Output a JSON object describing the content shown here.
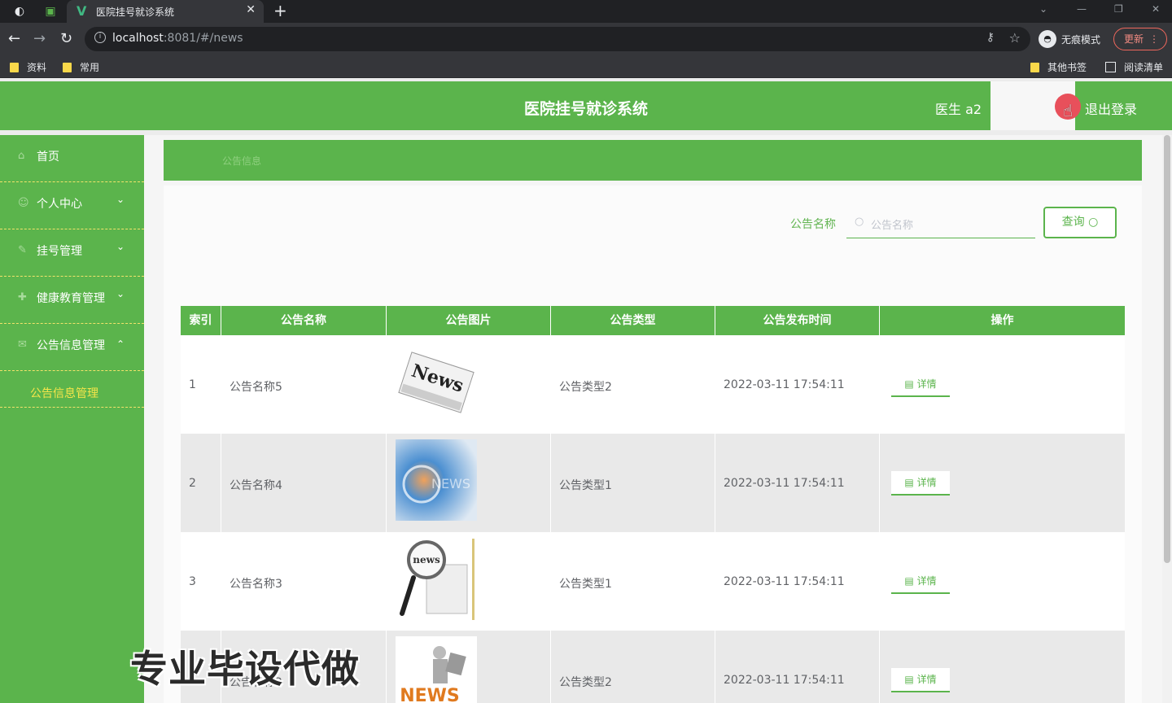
{
  "browser": {
    "tab_title": "医院挂号就诊系统",
    "url_host": "localhost",
    "url_path": ":8081/#/news",
    "incognito_label": "无痕模式",
    "update_label": "更新",
    "bookmarks": [
      "资料",
      "常用"
    ],
    "other_bookmarks": "其他书签",
    "reading_list": "阅读清单"
  },
  "header": {
    "title": "医院挂号就诊系统",
    "user": "医生 a2",
    "logout": "退出登录"
  },
  "sidebar": {
    "items": [
      {
        "label": "首页",
        "icon": "home-icon"
      },
      {
        "label": "个人中心",
        "icon": "user-icon"
      },
      {
        "label": "挂号管理",
        "icon": "register-icon"
      },
      {
        "label": "健康教育管理",
        "icon": "health-icon"
      },
      {
        "label": "公告信息管理",
        "icon": "notice-icon"
      }
    ],
    "active_sub": "公告信息管理"
  },
  "breadcrumb": "公告信息",
  "search": {
    "label": "公告名称",
    "placeholder": "公告名称",
    "button": "查询"
  },
  "table": {
    "headers": [
      "索引",
      "公告名称",
      "公告图片",
      "公告类型",
      "公告发布时间",
      "操作"
    ],
    "rows": [
      {
        "index": "1",
        "name": "公告名称5",
        "type": "公告类型2",
        "time": "2022-03-11 17:54:11",
        "action": "详情"
      },
      {
        "index": "2",
        "name": "公告名称4",
        "type": "公告类型1",
        "time": "2022-03-11 17:54:11",
        "action": "详情"
      },
      {
        "index": "3",
        "name": "公告名称3",
        "type": "公告类型1",
        "time": "2022-03-11 17:54:11",
        "action": "详情"
      },
      {
        "index": "4",
        "name": "公告名称2",
        "type": "公告类型2",
        "time": "2022-03-11 17:54:11",
        "action": "详情"
      }
    ]
  },
  "thumb_texts": [
    "News",
    "NEWS",
    "news",
    "NEWS"
  ],
  "watermark": "专业毕设代做",
  "colors": {
    "primary": "#5bb44c",
    "accent_yellow": "#f5e54a"
  }
}
